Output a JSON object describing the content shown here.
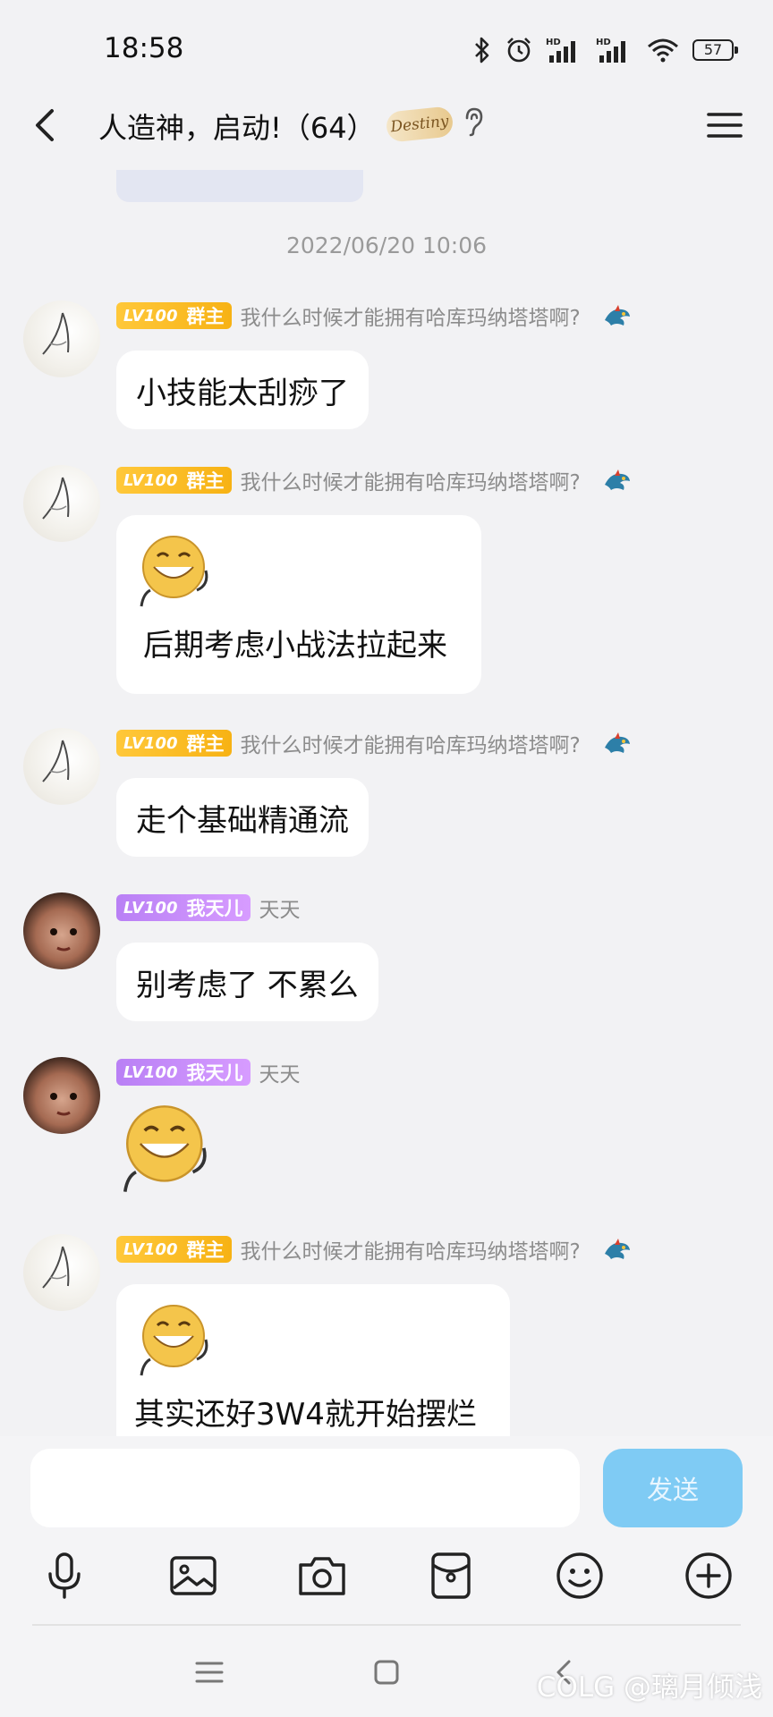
{
  "status": {
    "time": "18:58",
    "battery": "57",
    "hd1": "HD",
    "hd2": "HD"
  },
  "header": {
    "title": "人造神，启动!（64）",
    "badge": "Destiny"
  },
  "timestamp": "2022/06/20 10:06",
  "messages": [
    {
      "sender_level": "LV100",
      "sender_role": "群主",
      "sender_title": "我什么时候才能拥有哈库玛纳塔塔啊?",
      "text": "小技能太刮痧了"
    },
    {
      "sender_level": "LV100",
      "sender_role": "群主",
      "sender_title": "我什么时候才能拥有哈库玛纳塔塔啊?",
      "text": "后期考虑小战法拉起来"
    },
    {
      "sender_level": "LV100",
      "sender_role": "群主",
      "sender_title": "我什么时候才能拥有哈库玛纳塔塔啊?",
      "text": "走个基础精通流"
    },
    {
      "sender_level": "LV100",
      "sender_role": "我天儿",
      "sender_title": "天天",
      "text": "别考虑了 不累么"
    },
    {
      "sender_level": "LV100",
      "sender_role": "我天儿",
      "sender_title": "天天",
      "text": ""
    },
    {
      "sender_level": "LV100",
      "sender_role": "群主",
      "sender_title": "我什么时候才能拥有哈库玛纳塔塔啊?",
      "text": "其实还好3W4就开始摆烂"
    }
  ],
  "input": {
    "placeholder": "",
    "send_label": "发送"
  },
  "toolbar": [
    "microphone-icon",
    "image-icon",
    "camera-icon",
    "red-packet-icon",
    "emoji-icon",
    "plus-icon"
  ],
  "watermark": "@璃月倾浅",
  "watermark_prefix": "COLG",
  "colors": {
    "background": "#f2f2f4",
    "bubble": "#ffffff",
    "owner_badge": "#f7b214",
    "member_badge": "#c98cf8",
    "send_button": "#7fcbf4"
  }
}
